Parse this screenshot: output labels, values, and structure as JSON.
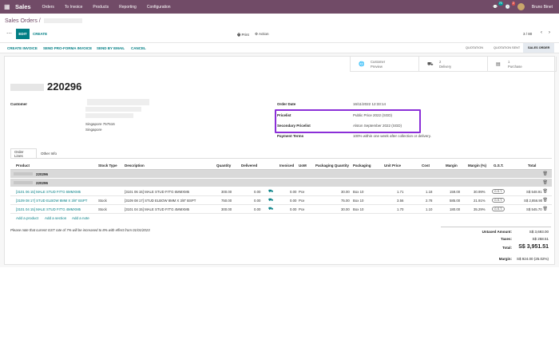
{
  "topbar": {
    "app_name": "Sales",
    "menus": [
      "Orders",
      "To Invoice",
      "Products",
      "Reporting",
      "Configuration"
    ],
    "chat_badge": "75",
    "activity_badge": "2",
    "user_name": "Bruno Binet"
  },
  "breadcrumb": {
    "root": "Sales Orders /"
  },
  "control": {
    "edit": "EDIT",
    "create": "CREATE",
    "print": "Print",
    "action": "Action",
    "pager": "3 / 80",
    "prev": "‹",
    "next": "›"
  },
  "actions": {
    "create_invoice": "CREATE INVOICE",
    "send_proforma": "SEND PRO-FORMA INVOICE",
    "send_email": "SEND BY EMAIL",
    "cancel": "CANCEL"
  },
  "statusbar": [
    "QUOTATION",
    "QUOTATION SENT",
    "SALES ORDER"
  ],
  "smart_buttons": [
    {
      "icon": "globe-icon",
      "line1": "Customer",
      "line2": "Preview"
    },
    {
      "icon": "truck-icon",
      "line1": "2",
      "line2": "Delivery"
    },
    {
      "icon": "invoice-icon",
      "line1": "1",
      "line2": "Purchase"
    }
  ],
  "order": {
    "number": "220296",
    "customer_label": "Customer",
    "address_city": "Singapore 757516",
    "address_country": "Singapore",
    "order_date_label": "Order Date",
    "order_date": "16/11/2022 12:33:14",
    "pricelist_label": "Pricelist",
    "pricelist": "Public Price 2022 (SGD)",
    "secondary_pricelist_label": "Secondary Pricelist",
    "secondary_pricelist": "Alston September 2022 (SGD)",
    "payment_terms_label": "Payment Terms",
    "payment_terms": "100% within one week after collection or delivery."
  },
  "tabs": [
    "Order Lines",
    "Other Info"
  ],
  "table": {
    "headers": [
      "Product",
      "Stock Type",
      "Description",
      "Quantity",
      "Delivered",
      "Invoiced",
      "UoM",
      "Packaging Quantity",
      "Packaging",
      "Unit Price",
      "Cost",
      "Margin",
      "Margin (%)",
      "G.S.T.",
      "Total"
    ],
    "sections": [
      "220296",
      "220296"
    ],
    "rows": [
      {
        "product": "[3101 06 15] MALE STUD FIT'G 6MMXM5",
        "stock_type": "",
        "description": "[3101 06 15] MALE STUD FIT'G 6MMXM5",
        "quantity": "300.00",
        "delivered": "0.00",
        "invoiced": "0.00",
        "uom": "Pce",
        "pack_qty": "30.00",
        "packaging": "Box 10",
        "unit_price": "1.71",
        "cost": "1.18",
        "margin": "159.00",
        "margin_pct": "30.99%",
        "tax": "G.S.T.",
        "total": "S$ 548.91"
      },
      {
        "product": "[3109 08 17] STUD ELBOW 8MM X 3/8\" BSPT",
        "stock_type": "Stock",
        "description": "[3109 08 17] STUD ELBOW 8MM X 3/8\" BSPT",
        "quantity": "750.00",
        "delivered": "0.00",
        "invoiced": "0.00",
        "uom": "Pce",
        "pack_qty": "75.00",
        "packaging": "Box 10",
        "unit_price": "3.56",
        "cost": "2.78",
        "margin": "585.00",
        "margin_pct": "21.91%",
        "tax": "G.S.T.",
        "total": "S$ 2,856.90"
      },
      {
        "product": "[3101 04 15] MALE STUD FIT'G 4MMXM5",
        "stock_type": "Stock",
        "description": "[3101 04 15] MALE STUD FIT'G 4MMXM5",
        "quantity": "300.00",
        "delivered": "0.00",
        "invoiced": "0.00",
        "uom": "Pce",
        "pack_qty": "30.00",
        "packaging": "Box 10",
        "unit_price": "1.70",
        "cost": "1.10",
        "margin": "180.00",
        "margin_pct": "35.29%",
        "tax": "G.S.T.",
        "total": "S$ 545.70"
      }
    ],
    "add_product": "Add a product",
    "add_section": "Add a section",
    "add_note": "Add a note"
  },
  "note": "Please note that current GST rate of 7% will be increased to 8% with effect from 01/01/2023",
  "totals": {
    "untaxed_label": "Untaxed Amount:",
    "untaxed": "S$ 3,693.00",
    "taxes_label": "Taxes:",
    "taxes": "S$ 258.51",
    "total_label": "Total:",
    "total": "S$ 3,951.51",
    "margin_label": "Margin:",
    "margin": "S$ 924.00 (25.02%)"
  }
}
